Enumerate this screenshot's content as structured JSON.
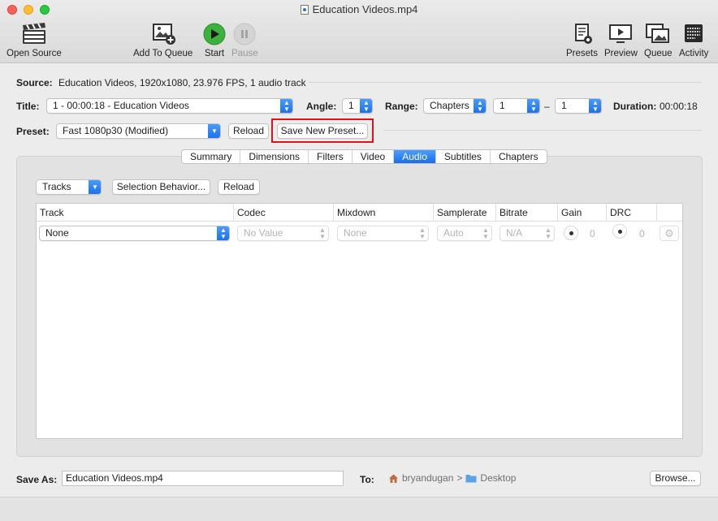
{
  "window": {
    "title": "Education Videos.mp4"
  },
  "toolbar": {
    "open_source": "Open Source",
    "add_to_queue": "Add To Queue",
    "start": "Start",
    "pause": "Pause",
    "presets": "Presets",
    "preview": "Preview",
    "queue": "Queue",
    "activity": "Activity"
  },
  "source": {
    "label": "Source:",
    "value": "Education Videos, 1920x1080, 23.976 FPS, 1 audio track"
  },
  "title_row": {
    "title_label": "Title:",
    "title_value": "1 - 00:00:18 - Education Videos",
    "angle_label": "Angle:",
    "angle_value": "1",
    "range_label": "Range:",
    "range_type": "Chapters",
    "range_start": "1",
    "range_dash": "–",
    "range_end": "1",
    "duration_label": "Duration:",
    "duration_value": "00:00:18"
  },
  "preset_row": {
    "label": "Preset:",
    "value": "Fast 1080p30 (Modified)",
    "reload": "Reload",
    "save_new": "Save New Preset..."
  },
  "tabs": [
    "Summary",
    "Dimensions",
    "Filters",
    "Video",
    "Audio",
    "Subtitles",
    "Chapters"
  ],
  "audio": {
    "tracks": "Tracks",
    "selection_behavior": "Selection Behavior...",
    "reload": "Reload",
    "columns": [
      "Track",
      "Codec",
      "Mixdown",
      "Samplerate",
      "Bitrate",
      "Gain",
      "DRC"
    ],
    "row": {
      "track": "None",
      "codec": "No Value",
      "mixdown": "None",
      "samplerate": "Auto",
      "bitrate": "N/A",
      "gain": "0",
      "drc": "0"
    }
  },
  "save": {
    "label": "Save As:",
    "filename": "Education Videos.mp4",
    "to_label": "To:",
    "path_user": "bryandugan",
    "path_sep": ">",
    "path_folder": "Desktop",
    "browse": "Browse..."
  }
}
